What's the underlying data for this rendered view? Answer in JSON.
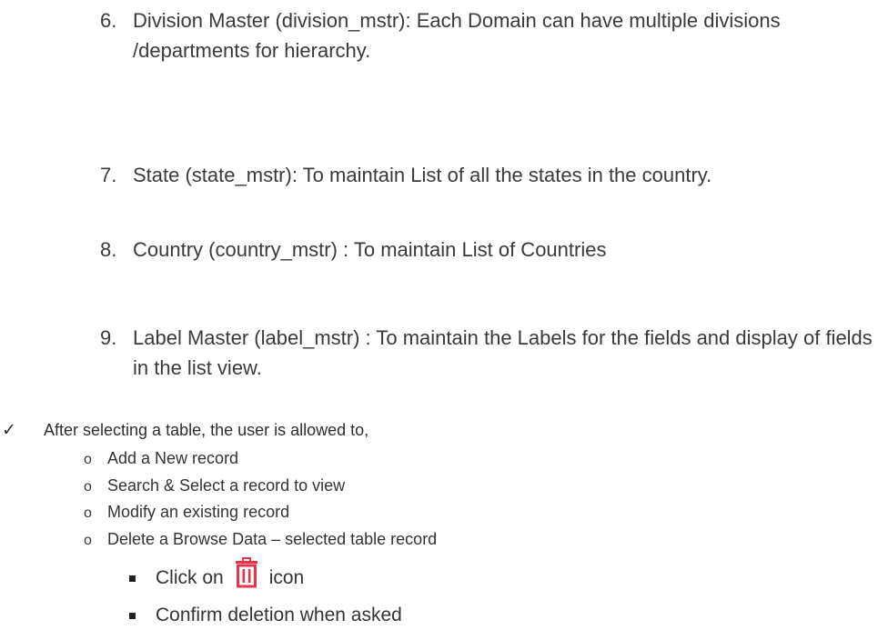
{
  "numbered_items": [
    {
      "number": "6.",
      "text": "Division Master (division_mstr): Each Domain can have multiple divisions /departments for hierarchy."
    },
    {
      "number": "7.",
      "text": "State (state_mstr): To maintain List of all the states in the country."
    },
    {
      "number": "8.",
      "text": "Country (country_mstr) : To maintain List of  Countries"
    },
    {
      "number": "9.",
      "text": "Label Master (label_mstr) : To maintain the Labels for the fields and display of fields in the list view."
    }
  ],
  "check_item": {
    "symbol": "✓",
    "text": "After selecting a table, the user is allowed to,"
  },
  "sub_bullet_symbol": "o",
  "sub_items": [
    "Add a New record",
    "Search & Select a record to view",
    "Modify an existing record",
    "Delete a Browse Data – selected table record"
  ],
  "nested_items": {
    "click_prefix": "Click on",
    "click_suffix": "icon",
    "icon_name": "trash-icon",
    "icon_color": "#e8334a",
    "confirm": "Confirm deletion when asked"
  }
}
